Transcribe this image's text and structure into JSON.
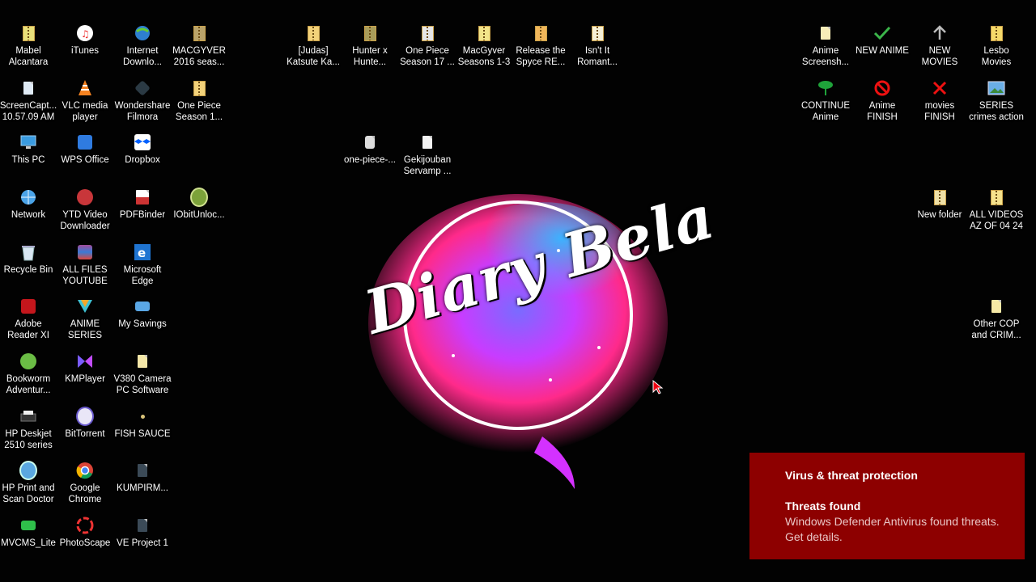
{
  "desktop_icons": {
    "mabel": "Mabel\nAlcantara",
    "itunes": "iTunes",
    "internet_download": "Internet\nDownlo...",
    "macgyver_2016": "MACGYVER\n2016 seas...",
    "judas": "[Judas]\nKatsute Ka...",
    "hunter": "Hunter x\nHunte...",
    "one_piece_17": "One Piece\nSeason 17 ...",
    "macgyver_1_3": "MacGyver\nSeasons 1-3",
    "release_spyce": "Release the\nSpyce  RE...",
    "isnt_it": "Isn't It\nRomant...",
    "anime_screenshot": "Anime\nScreensh...",
    "new_anime": "NEW ANIME",
    "new_movies": "NEW MOVIES",
    "lesbo_movies": "Lesbo\nMovies",
    "screencapture": "ScreenCapt...\n10.57.09 AM",
    "vlc": "VLC media\nplayer",
    "wondershare": "Wondershare\nFilmora",
    "one_piece_1": "One Piece\nSeason 1...",
    "continue_anime": "CONTINUE\nAnime",
    "anime_finish": "Anime\nFINISH",
    "movies_finish": "movies\nFINISH",
    "series_crimes": "SERIES\ncrimes action",
    "this_pc": "This PC",
    "wps_office": "WPS Office",
    "dropbox": "Dropbox",
    "one_piece_file": "one-piece-...",
    "gekijouban": "Gekijouban\nServamp ...",
    "network": "Network",
    "ytd": "YTD Video\nDownloader",
    "pdfbinder": "PDFBinder",
    "iobit": "IObitUnloc...",
    "new_folder": "New folder",
    "all_videos": "ALL VIDEOS\nAZ OF 04 24",
    "recycle_bin": "Recycle Bin",
    "all_files_youtube": "ALL FILES\nYOUTUBE",
    "edge": "Microsoft\nEdge",
    "adobe": "Adobe\nReader XI",
    "anime_series": "ANIME\nSERIES",
    "my_savings": "My Savings",
    "other_cop": "Other COP\nand CRIM...",
    "bookworm": "Bookworm\nAdventur...",
    "kmplayer": "KMPlayer",
    "v380": "V380 Camera\nPC Software",
    "hp_deskjet": "HP Deskjet\n2510 series",
    "bittorrent": "BitTorrent",
    "fish_sauce": "FISH SAUCE",
    "hp_print": "HP Print and\nScan Doctor",
    "chrome": "Google\nChrome",
    "kumpirm": "KUMPIRM...",
    "mvcms": "MVCMS_Lite",
    "photoscape": "PhotoScape",
    "ve_project": "VE Project 1"
  },
  "logo_text": "Diary Bela",
  "toast": {
    "title": "Virus & threat protection",
    "heading": "Threats found",
    "body": "Windows Defender Antivirus found threats. Get details."
  },
  "colors": {
    "toast_bg": "#8d0000",
    "desktop_bg": "#020202"
  }
}
